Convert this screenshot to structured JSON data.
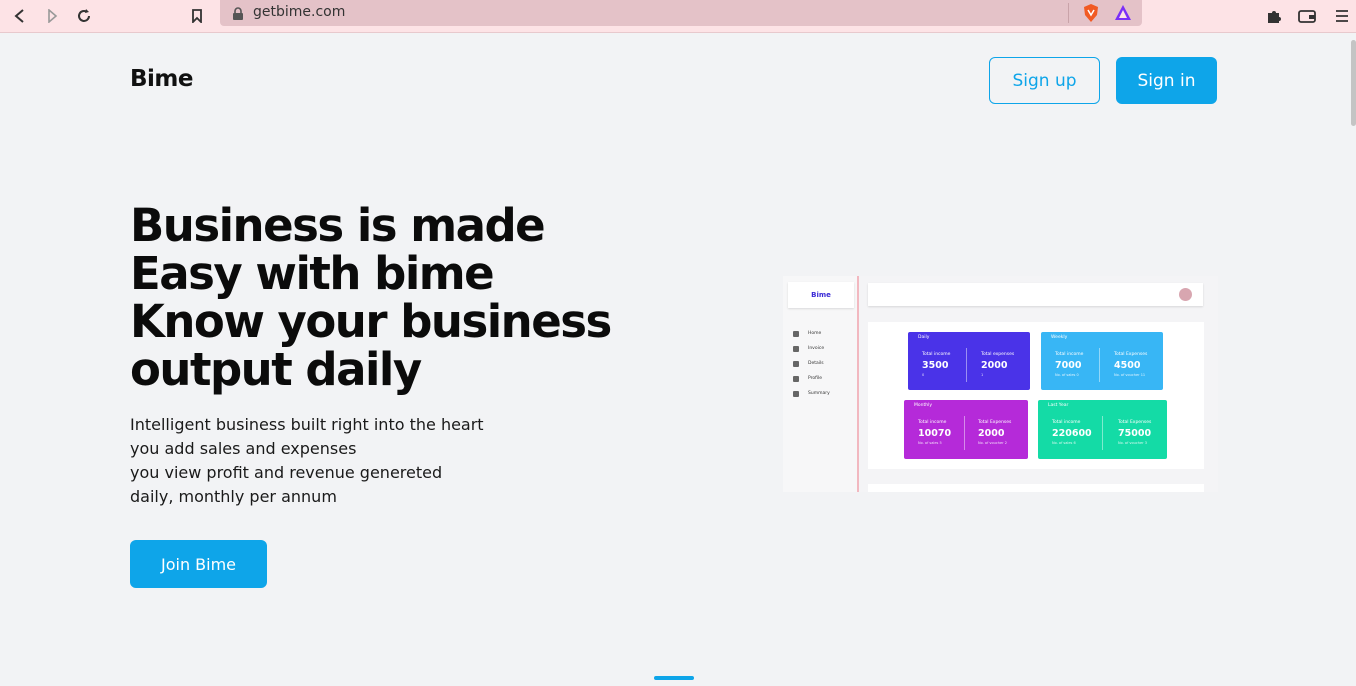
{
  "browser": {
    "url": "getbime.com",
    "back_icon": "back-arrow-icon",
    "forward_icon": "forward-arrow-icon",
    "reload_icon": "reload-icon",
    "bookmark_icon": "bookmark-icon",
    "lock_icon": "lock-icon",
    "brave_icon": "brave-shield-icon",
    "rewards_icon": "brave-rewards-icon",
    "extensions_icon": "puzzle-icon",
    "wallet_icon": "wallet-icon",
    "menu_icon": "hamburger-menu-icon",
    "chrome_color": "#fde3e6"
  },
  "header": {
    "logo": "Bime",
    "signup_label": "Sign up",
    "signin_label": "Sign in"
  },
  "hero": {
    "title_lines": [
      "Business is made",
      "Easy with bime",
      "Know your business",
      "output daily"
    ],
    "desc_lines": [
      "Intelligent business built right into the heart",
      "you add sales and expenses",
      "you view profit and revenue genereted",
      "daily, monthly per annum"
    ],
    "cta_label": "Join Bime"
  },
  "preview": {
    "logo": "Bime",
    "menu": [
      "Home",
      "Invoice",
      "Details",
      "Profile",
      "Summary"
    ],
    "cards": [
      {
        "title": "Daily",
        "color": "#4a33e8",
        "left": {
          "label": "Total income",
          "value": "3500",
          "sub": "0"
        },
        "right": {
          "label": "Total expenses",
          "value": "2000",
          "sub": "1"
        }
      },
      {
        "title": "Weekly",
        "color": "#38b6f5",
        "left": {
          "label": "Total income",
          "value": "7000",
          "sub": "No. of sales 0"
        },
        "right": {
          "label": "Total Expenses",
          "value": "4500",
          "sub": "No. of voucher 11"
        }
      },
      {
        "title": "Monthly",
        "color": "#b52ad9",
        "left": {
          "label": "Total income",
          "value": "10070",
          "sub": "No. of sales 5"
        },
        "right": {
          "label": "Total Expenses",
          "value": "2000",
          "sub": "No. of voucher 2"
        }
      },
      {
        "title": "Last Year",
        "color": "#14dba6",
        "left": {
          "label": "Total income",
          "value": "220600",
          "sub": "No. of sales 6"
        },
        "right": {
          "label": "Total Expenses",
          "value": "75000",
          "sub": "No. of voucher 3"
        }
      }
    ]
  },
  "theme": {
    "accent": "#0ea5e9",
    "page_bg": "#f2f3f5"
  }
}
